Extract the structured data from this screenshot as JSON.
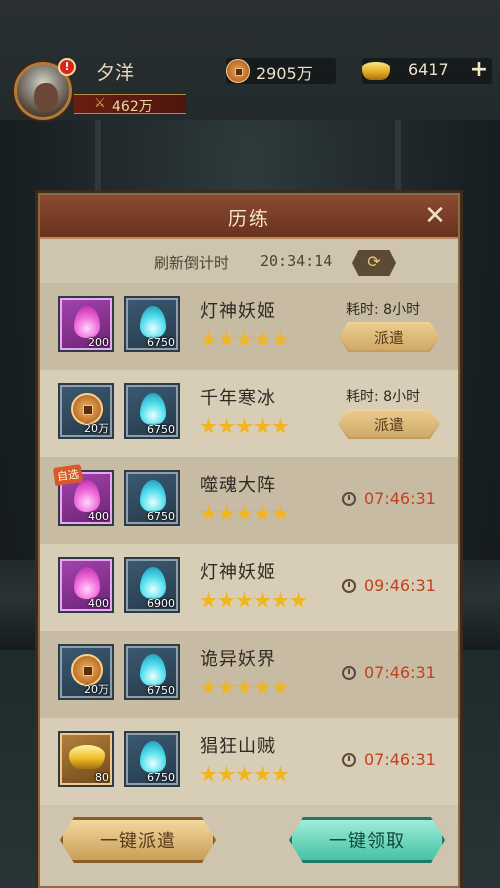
{
  "player": {
    "name": "夕洋",
    "alert": "!",
    "power": "462万"
  },
  "currency": {
    "copper": "2905万",
    "ingot": "6417",
    "plus": "+"
  },
  "panel": {
    "title": "历练",
    "close": "✕",
    "refresh_label": "刷新倒计时",
    "refresh_time": "20:34:14",
    "refresh_icon": "⟳"
  },
  "tasks": [
    {
      "name": "灯神妖姬",
      "stars": 5,
      "reward1": {
        "icon": "pink-flame-icon",
        "qty": "200"
      },
      "reward2": {
        "icon": "cyan-flame-icon",
        "qty": "6750"
      },
      "duration": "耗时: 8小时",
      "action": "派遣"
    },
    {
      "name": "千年寒冰",
      "stars": 5,
      "reward1": {
        "icon": "copper-coin-icon",
        "qty": "20万"
      },
      "reward2": {
        "icon": "cyan-flame-icon",
        "qty": "6750"
      },
      "duration": "耗时: 8小时",
      "action": "派遣"
    },
    {
      "name": "噬魂大阵",
      "stars": 5,
      "auto_tag": "自选",
      "reward1": {
        "icon": "pink-flame-icon",
        "qty": "400"
      },
      "reward2": {
        "icon": "cyan-flame-icon",
        "qty": "6750"
      },
      "timer": "07:46:31"
    },
    {
      "name": "灯神妖姬",
      "stars": 6,
      "reward1": {
        "icon": "pink-flame-icon",
        "qty": "400"
      },
      "reward2": {
        "icon": "cyan-flame-icon",
        "qty": "6900"
      },
      "timer": "09:46:31"
    },
    {
      "name": "诡异妖界",
      "stars": 5,
      "reward1": {
        "icon": "copper-coin-icon",
        "qty": "20万"
      },
      "reward2": {
        "icon": "cyan-flame-icon",
        "qty": "6750"
      },
      "timer": "07:46:31"
    },
    {
      "name": "猖狂山贼",
      "stars": 5,
      "reward1": {
        "icon": "gold-ingot-icon",
        "qty": "80"
      },
      "reward2": {
        "icon": "cyan-flame-icon",
        "qty": "6750"
      },
      "timer": "07:46:31"
    }
  ],
  "buttons": {
    "dispatch_all": "一键派遣",
    "claim_all": "一键领取"
  },
  "colors": {
    "timer": "#c0421f",
    "star": "#f2b61c",
    "claim_button": "#3fbfa0"
  }
}
